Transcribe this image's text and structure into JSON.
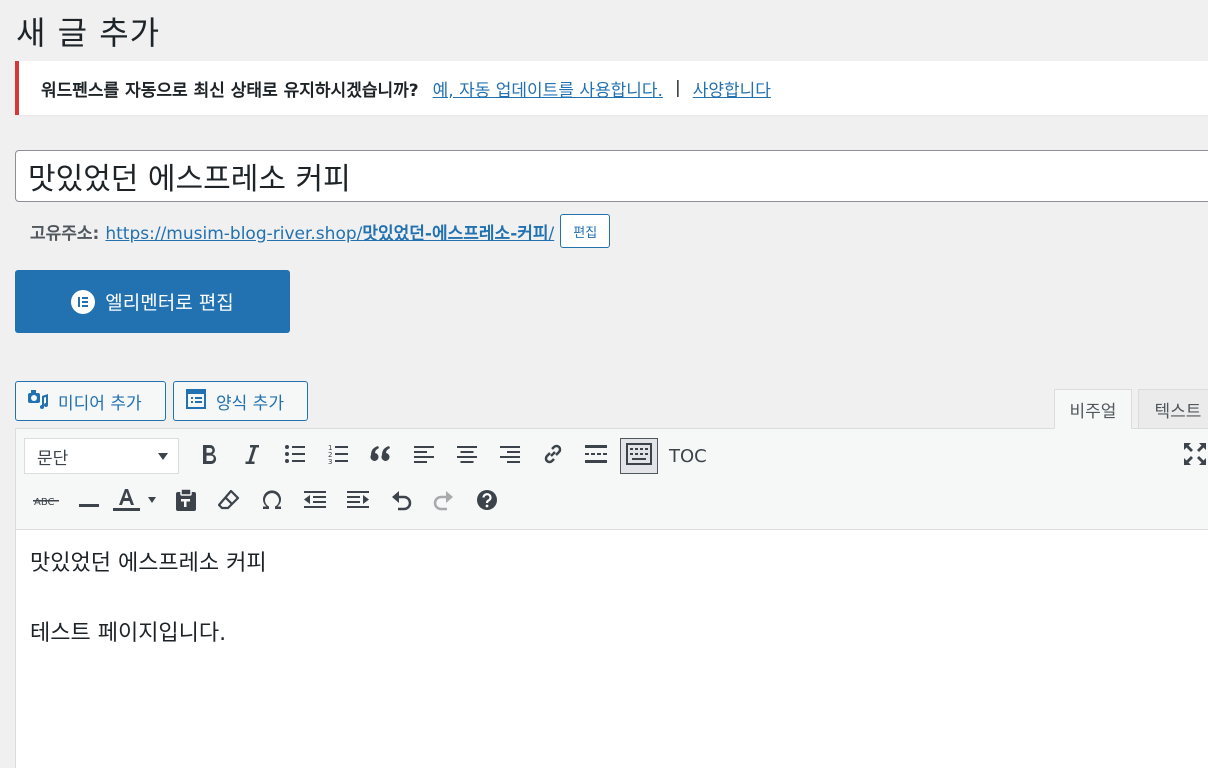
{
  "page": {
    "title": "새 글 추가"
  },
  "notice": {
    "question": "워드펜스를 자동으로 최신 상태로 유지하시겠습니까?",
    "yes_link": "예, 자동 업데이트를 사용합니다.",
    "separator": "|",
    "no_link": "사양합니다",
    "border_color": "#d63638"
  },
  "post": {
    "title": "맛있었던 에스프레소 커피"
  },
  "permalink": {
    "label": "고유주소:",
    "url_base": "https://musim-blog-river.shop/",
    "slug": "맛있었던-에스프레소-커피",
    "trailing": "/",
    "edit_label": "편집"
  },
  "elementor": {
    "label": "엘리멘터로 편집"
  },
  "media": {
    "add_media": "미디어 추가",
    "add_form": "양식 추가"
  },
  "tabs": {
    "visual": "비주얼",
    "text": "텍스트"
  },
  "toolbar": {
    "format_value": "문단",
    "toc_label": "TOC"
  },
  "content": {
    "paragraph1": "맛있었던 에스프레소 커피",
    "paragraph2": "테스트 페이지입니다."
  },
  "colors": {
    "accent": "#2271b1"
  }
}
